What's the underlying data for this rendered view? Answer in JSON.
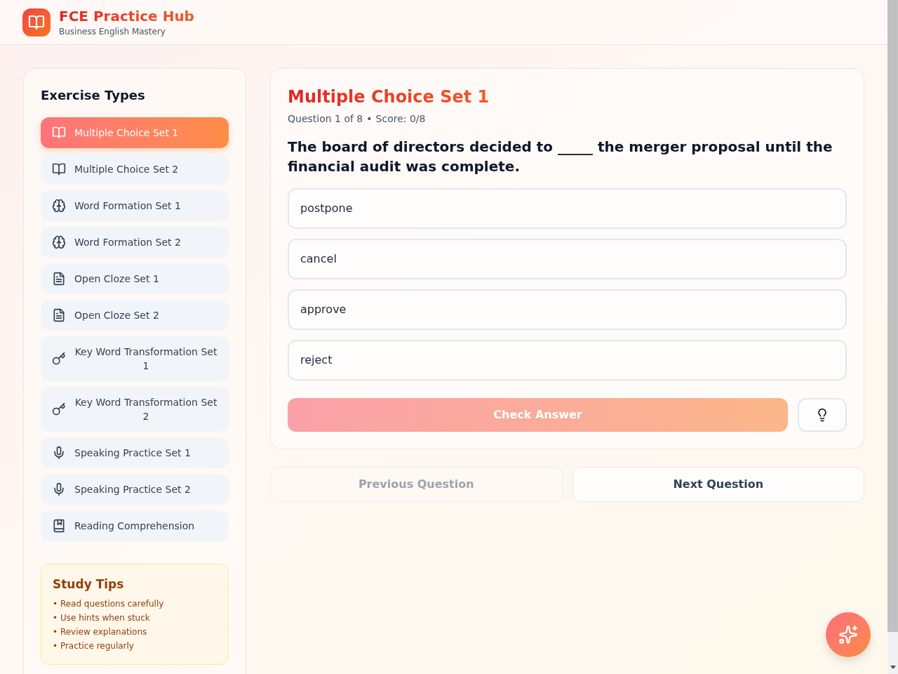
{
  "header": {
    "title": "FCE Practice Hub",
    "subtitle": "Business English Mastery"
  },
  "sidebar": {
    "heading": "Exercise Types",
    "items": [
      {
        "label": "Multiple Choice Set 1",
        "kind": "book",
        "selected": true
      },
      {
        "label": "Multiple Choice Set 2",
        "kind": "book",
        "selected": false
      },
      {
        "label": "Word Formation Set 1",
        "kind": "brain",
        "selected": false
      },
      {
        "label": "Word Formation Set 2",
        "kind": "brain",
        "selected": false
      },
      {
        "label": "Open Cloze Set 1",
        "kind": "document",
        "selected": false
      },
      {
        "label": "Open Cloze Set 2",
        "kind": "document",
        "selected": false
      },
      {
        "label": "Key Word Transformation Set 1",
        "kind": "key",
        "selected": false
      },
      {
        "label": "Key Word Transformation Set 2",
        "kind": "key",
        "selected": false
      },
      {
        "label": "Speaking Practice Set 1",
        "kind": "mic",
        "selected": false
      },
      {
        "label": "Speaking Practice Set 2",
        "kind": "mic",
        "selected": false
      },
      {
        "label": "Reading Comprehension",
        "kind": "bookmark",
        "selected": false
      }
    ]
  },
  "study_tips": {
    "title": "Study Tips",
    "tips": [
      "• Read questions carefully",
      "• Use hints when stuck",
      "• Review explanations",
      "• Practice regularly"
    ]
  },
  "exercise": {
    "title": "Multiple Choice Set 1",
    "counter": "Question 1 of 8",
    "separator": "•",
    "score": "Score: 0/8",
    "question": "The board of directors decided to _____ the merger proposal until the financial audit was complete.",
    "options": [
      {
        "label": "postpone",
        "selected": false
      },
      {
        "label": "cancel",
        "selected": false
      },
      {
        "label": "approve",
        "selected": false
      },
      {
        "label": "reject",
        "selected": false
      }
    ],
    "check_button": {
      "label": "Check Answer",
      "disabled": true
    }
  },
  "navigation": [
    {
      "label": "Previous Question",
      "disabled": true
    },
    {
      "label": "Next Question",
      "disabled": false
    }
  ]
}
